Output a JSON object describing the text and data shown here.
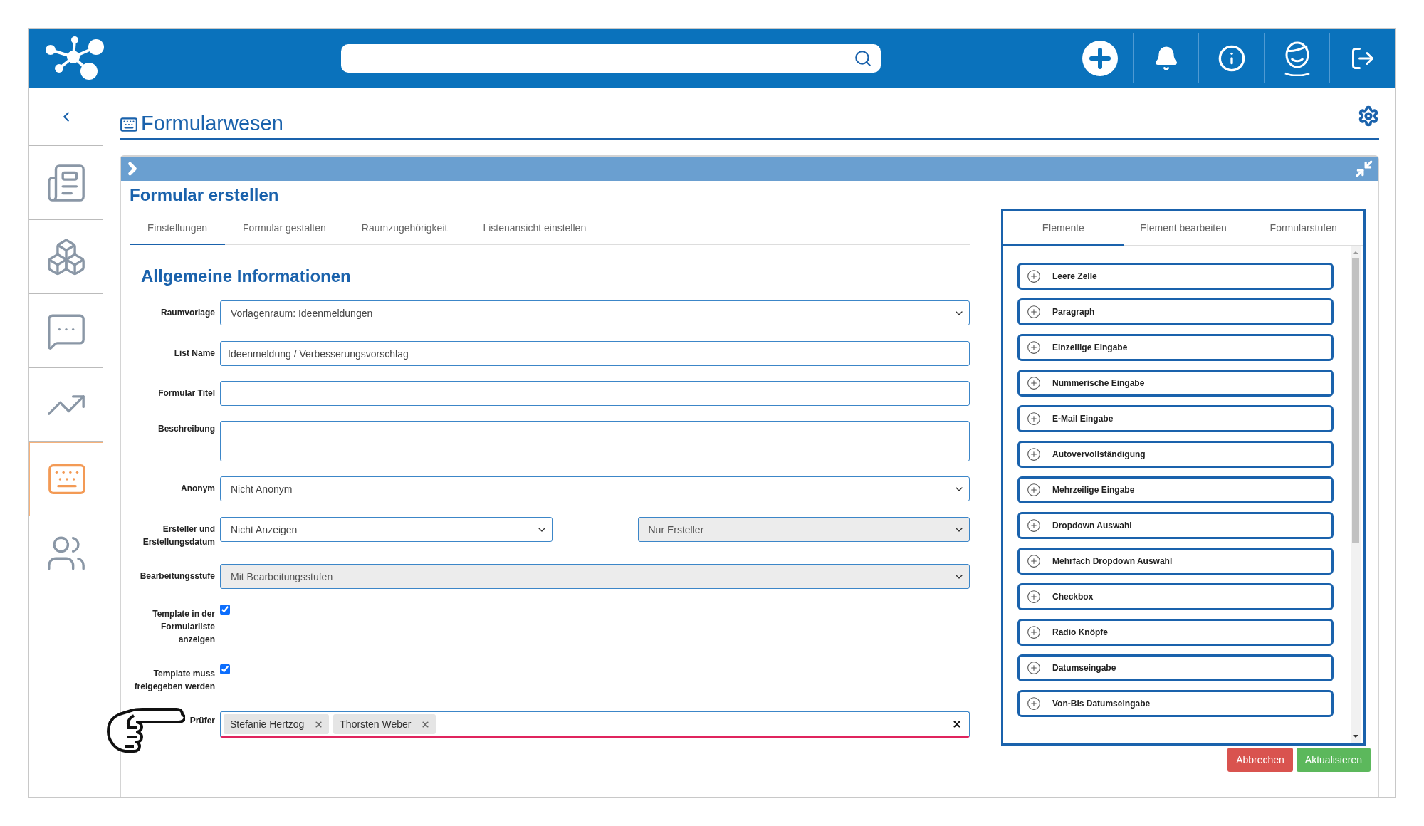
{
  "sidebar": {
    "items": [
      {
        "selected": false
      },
      {
        "selected": false
      },
      {
        "selected": false
      },
      {
        "selected": false
      },
      {
        "selected": true
      },
      {
        "selected": false
      }
    ]
  },
  "page": {
    "title": "Formularwesen"
  },
  "panel": {
    "title": "Formular erstellen",
    "tabs": [
      {
        "label": "Einstellungen",
        "selected": true
      },
      {
        "label": "Formular gestalten",
        "selected": false
      },
      {
        "label": "Raumzugehörigkeit",
        "selected": false
      },
      {
        "label": "Listenansicht einstellen",
        "selected": false
      }
    ],
    "section": "Allgemeine Informationen",
    "fields": [
      {
        "label": "Raumvorlage",
        "kind": "select",
        "selects": [
          {
            "value": "Vorlagenraum: Ideenmeldungen",
            "disabled": false
          }
        ]
      },
      {
        "label": "List Name",
        "kind": "text",
        "value": "Ideenmeldung / Verbesserungsvorschlag"
      },
      {
        "label": "Formular Titel",
        "kind": "text"
      },
      {
        "label": "Beschreibung",
        "kind": "textarea"
      },
      {
        "label": "Anonym",
        "kind": "select",
        "selects": [
          {
            "value": "Nicht Anonym",
            "disabled": false
          }
        ]
      },
      {
        "label": "Ersteller und Erstellungsdatum",
        "kind": "select",
        "selects": [
          {
            "value": "Nicht Anzeigen",
            "disabled": false
          },
          {
            "value": "Nur Ersteller",
            "disabled": true
          }
        ]
      },
      {
        "label": "Bearbeitungsstufe",
        "kind": "select",
        "selects": [
          {
            "value": "Mit Bearbeitungsstufen",
            "disabled": true
          }
        ]
      },
      {
        "label": "Template in der Formularliste anzeigen",
        "kind": "checkbox",
        "checked": true
      },
      {
        "label": "Template muss freigegeben werden",
        "kind": "checkbox",
        "checked": true
      },
      {
        "label": "Prüfer",
        "kind": "tags",
        "tags": [
          "Stefanie Hertzog",
          "Thorsten Weber"
        ]
      }
    ],
    "side_tabs": [
      {
        "label": "Elemente",
        "selected": true
      },
      {
        "label": "Element bearbeiten",
        "selected": false
      },
      {
        "label": "Formularstufen",
        "selected": false
      }
    ],
    "elements": [
      "Leere Zelle",
      "Paragraph",
      "Einzeilige Eingabe",
      "Nummerische Eingabe",
      "E-Mail Eingabe",
      "Autovervollständigung",
      "Mehrzeilige Eingabe",
      "Dropdown Auswahl",
      "Mehrfach Dropdown Auswahl",
      "Checkbox",
      "Radio Knöpfe",
      "Datumseingabe",
      "Von-Bis Datumseingabe"
    ],
    "buttons": [
      {
        "label": "Abbrechen",
        "kind": "cancel"
      },
      {
        "label": "Aktualisieren",
        "kind": "confirm"
      }
    ]
  }
}
